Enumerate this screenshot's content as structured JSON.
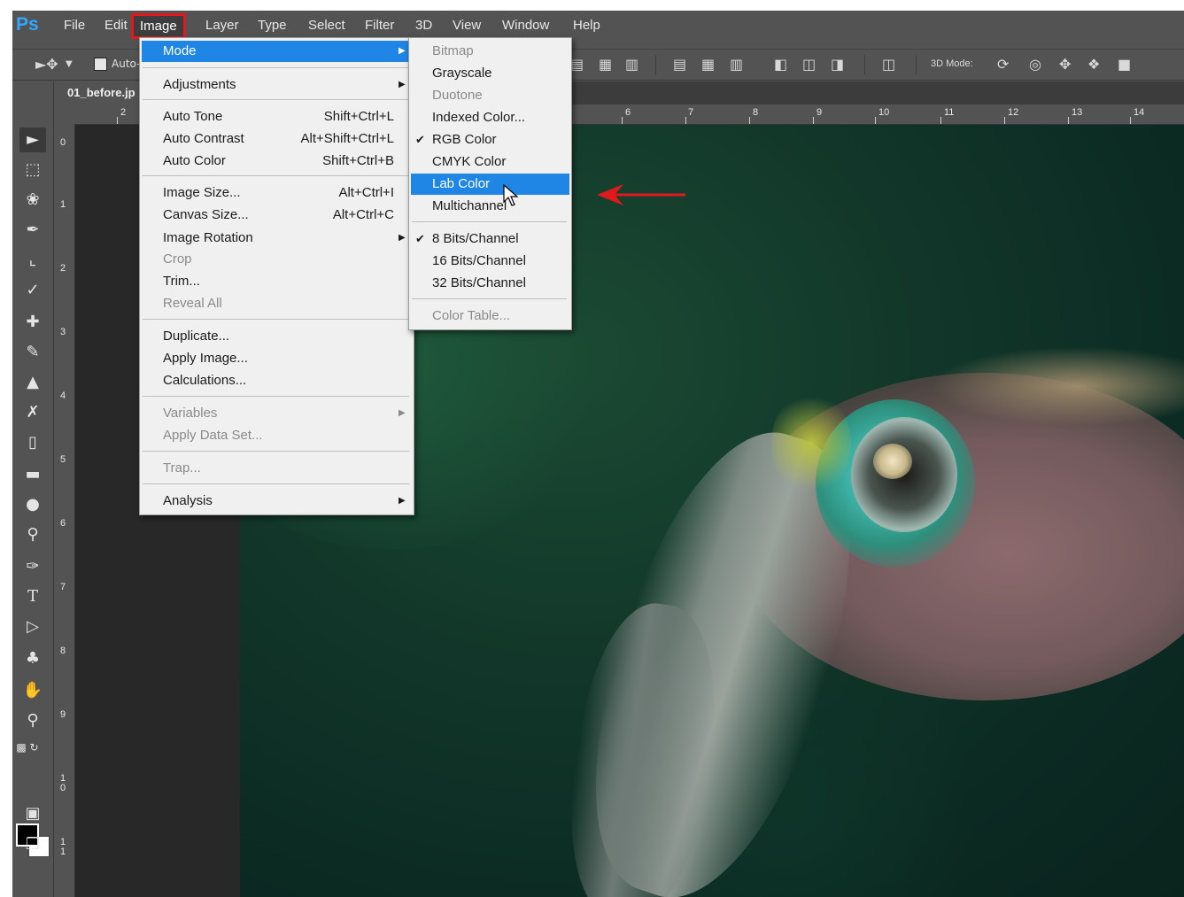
{
  "app": {
    "logo": "Ps"
  },
  "menubar": {
    "items": [
      "File",
      "Edit",
      "Image",
      "Layer",
      "Type",
      "Select",
      "Filter",
      "3D",
      "View",
      "Window",
      "Help"
    ],
    "active": "Image"
  },
  "options_bar": {
    "auto_label": "Auto-",
    "mode_3d_label": "3D Mode:"
  },
  "document_tab": {
    "title": "01_before.jp"
  },
  "rulers": {
    "top_visible": [
      "2",
      "6",
      "7",
      "8",
      "9",
      "10",
      "11",
      "12",
      "13",
      "14"
    ],
    "left": [
      "0",
      "1",
      "2",
      "3",
      "4",
      "5",
      "6",
      "7",
      "8",
      "9",
      "10",
      "11"
    ]
  },
  "image_menu": {
    "mode": "Mode",
    "adjustments": "Adjustments",
    "auto_tone": "Auto Tone",
    "auto_tone_sc": "Shift+Ctrl+L",
    "auto_contrast": "Auto Contrast",
    "auto_contrast_sc": "Alt+Shift+Ctrl+L",
    "auto_color": "Auto Color",
    "auto_color_sc": "Shift+Ctrl+B",
    "image_size": "Image Size...",
    "image_size_sc": "Alt+Ctrl+I",
    "canvas_size": "Canvas Size...",
    "canvas_size_sc": "Alt+Ctrl+C",
    "image_rotation": "Image Rotation",
    "crop": "Crop",
    "trim": "Trim...",
    "reveal_all": "Reveal All",
    "duplicate": "Duplicate...",
    "apply_image": "Apply Image...",
    "calculations": "Calculations...",
    "variables": "Variables",
    "apply_data_set": "Apply Data Set...",
    "trap": "Trap...",
    "analysis": "Analysis"
  },
  "mode_menu": {
    "bitmap": "Bitmap",
    "grayscale": "Grayscale",
    "duotone": "Duotone",
    "indexed": "Indexed Color...",
    "rgb": "RGB Color",
    "cmyk": "CMYK Color",
    "lab": "Lab Color",
    "multichannel": "Multichannel",
    "bits8": "8 Bits/Channel",
    "bits16": "16 Bits/Channel",
    "bits32": "32 Bits/Channel",
    "color_table": "Color Table...",
    "checked": [
      "RGB Color",
      "8 Bits/Channel"
    ],
    "highlighted": "Lab Color"
  },
  "colors": {
    "highlight": "#1f86e5",
    "annotation_red": "#e0191c",
    "ps_blue": "#31a8ff"
  }
}
